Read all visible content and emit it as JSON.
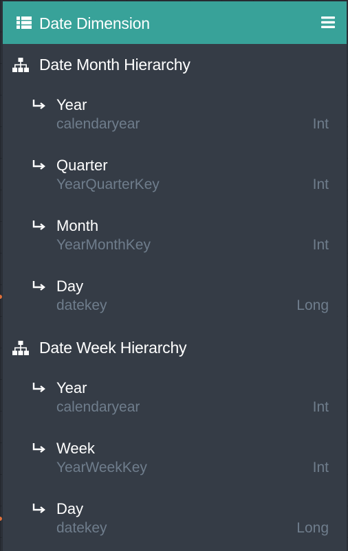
{
  "panel": {
    "title": "Date Dimension",
    "title_icon": "table-list-icon",
    "menu_icon": "hamburger-menu-icon"
  },
  "colors": {
    "header_bg": "#38a299",
    "panel_bg": "#353c46",
    "text_primary": "#ffffff",
    "text_secondary": "#6f7d8c",
    "connector_dot": "#e0703a"
  },
  "hierarchies": [
    {
      "title": "Date Month Hierarchy",
      "icon": "hierarchy-icon",
      "levels": [
        {
          "name": "Year",
          "column": "calendaryear",
          "type": "Int"
        },
        {
          "name": "Quarter",
          "column": "YearQuarterKey",
          "type": "Int"
        },
        {
          "name": "Month",
          "column": "YearMonthKey",
          "type": "Int"
        },
        {
          "name": "Day",
          "column": "datekey",
          "type": "Long"
        }
      ]
    },
    {
      "title": "Date Week Hierarchy",
      "icon": "hierarchy-icon",
      "levels": [
        {
          "name": "Year",
          "column": "calendaryear",
          "type": "Int"
        },
        {
          "name": "Week",
          "column": "YearWeekKey",
          "type": "Int"
        },
        {
          "name": "Day",
          "column": "datekey",
          "type": "Long"
        }
      ]
    }
  ]
}
